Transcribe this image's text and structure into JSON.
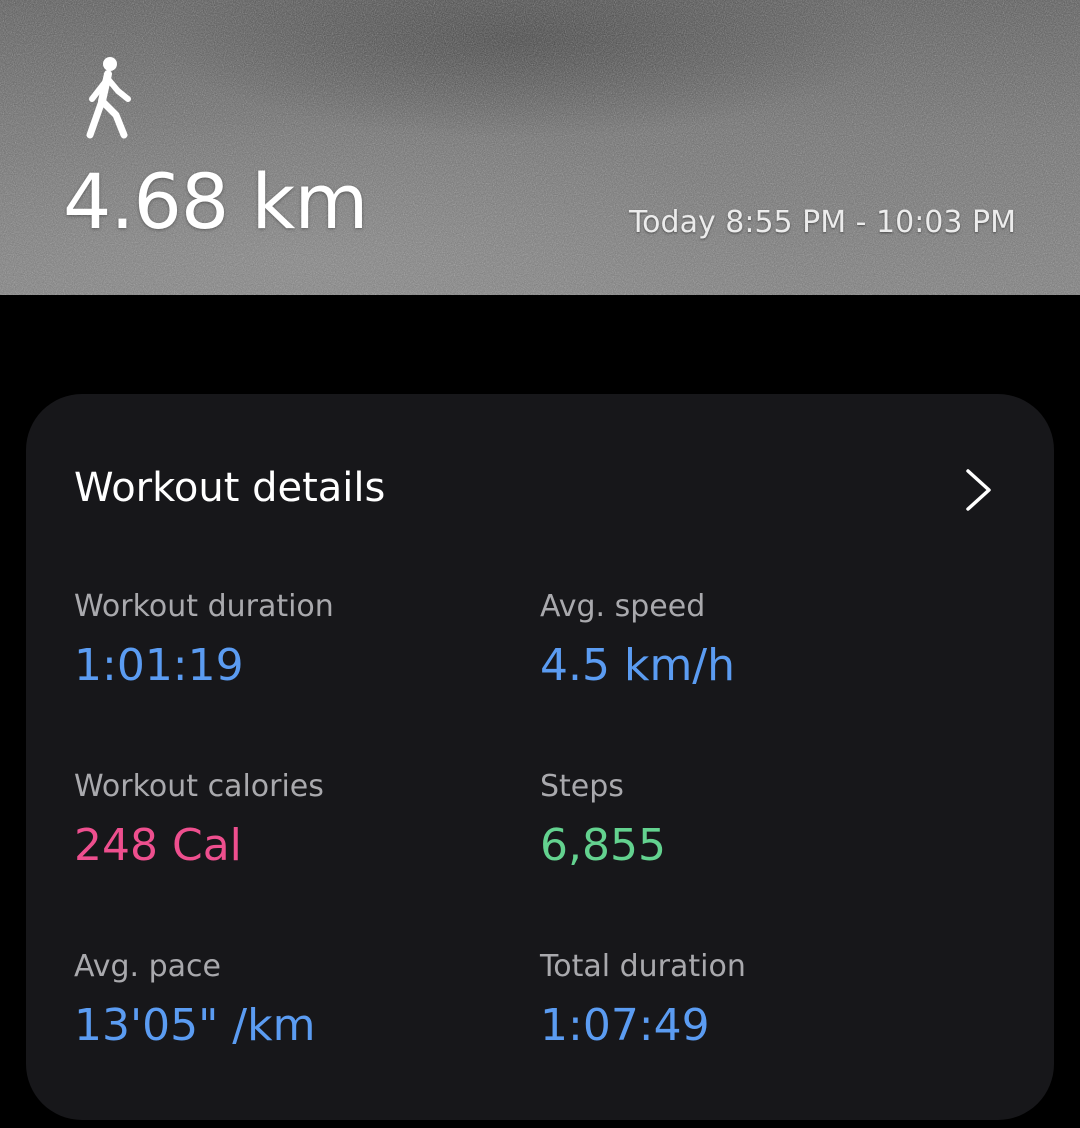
{
  "hero": {
    "activity_icon": "walking-person-icon",
    "distance": "4.68 km",
    "time_range": "Today 8:55 PM - 10:03 PM"
  },
  "workout_details": {
    "title": "Workout details",
    "chevron_icon": "chevron-right-icon",
    "stats": {
      "workout_duration": {
        "label": "Workout duration",
        "value": "1:01:19",
        "color": "#5b9cf2"
      },
      "avg_speed": {
        "label": "Avg. speed",
        "value": "4.5 km/h",
        "color": "#5b9cf2"
      },
      "workout_calories": {
        "label": "Workout calories",
        "value": "248 Cal",
        "color": "#ee4f8e"
      },
      "steps": {
        "label": "Steps",
        "value": "6,855",
        "color": "#63d28f"
      },
      "avg_pace": {
        "label": "Avg. pace",
        "value": "13'05\" /km",
        "color": "#5b9cf2"
      },
      "total_duration": {
        "label": "Total duration",
        "value": "1:07:49",
        "color": "#5b9cf2"
      }
    }
  },
  "colors": {
    "background": "#000000",
    "card": "#17171a",
    "label": "#a9a9ad",
    "title": "#ffffff"
  }
}
